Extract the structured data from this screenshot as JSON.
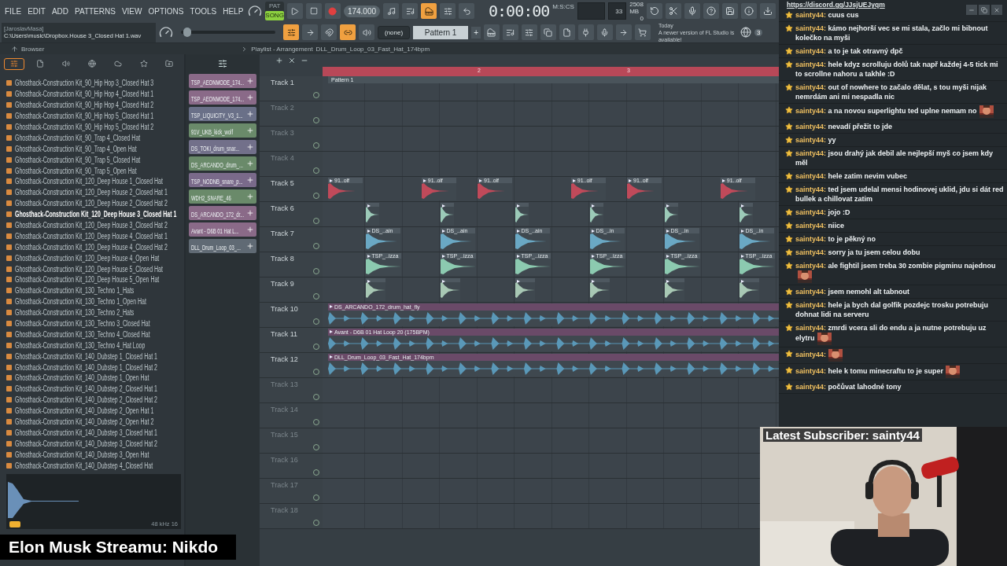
{
  "menu": [
    "FILE",
    "EDIT",
    "ADD",
    "PATTERNS",
    "VIEW",
    "OPTIONS",
    "TOOLS",
    "HELP"
  ],
  "transport": {
    "modes": [
      {
        "label": "PAT",
        "selected": false
      },
      {
        "label": "SONG",
        "selected": true
      }
    ],
    "tempo": "174.000",
    "time": "0:00:00",
    "time_unit": "M:S:CS",
    "cpu": "33",
    "memory": "2508 MB",
    "polyphony": "0"
  },
  "toggles_top": [
    {
      "on": false
    },
    {
      "on": false
    },
    {
      "on": true
    },
    {
      "on": false
    },
    {
      "on": false
    }
  ],
  "hint": {
    "title": "[JaroslavMasa]",
    "text": "C:\\Users\\music\\Dropbox.House 3_Closed Hat 1.wav"
  },
  "master_slider": {
    "level": 0.03
  },
  "toggles": [
    {
      "on": true
    },
    {
      "on": false
    },
    {
      "on": false
    },
    {
      "on": true
    },
    {
      "on": false
    }
  ],
  "snap": "(none)",
  "pattern": {
    "name": "Pattern 1",
    "add": "+"
  },
  "news": {
    "date": "Today",
    "text": "A newer version of FL Studio is available!",
    "count": "3"
  },
  "browser": {
    "title": "Browser",
    "tabs": [
      {
        "selected": true
      },
      {
        "selected": false
      },
      {
        "selected": false
      },
      {
        "selected": false
      },
      {
        "selected": false
      },
      {
        "selected": false
      },
      {
        "selected": false
      }
    ],
    "items": [
      {
        "name": "Ghosthack-Construction Kit_90_Hip Hop 3_Closed Hat 3",
        "selected": false
      },
      {
        "name": "Ghosthack-Construction Kit_90_Hip Hop 4_Closed Hat 1",
        "selected": false
      },
      {
        "name": "Ghosthack-Construction Kit_90_Hip Hop 4_Closed Hat 2",
        "selected": false
      },
      {
        "name": "Ghosthack-Construction Kit_90_Hip Hop 5_Closed Hat 1",
        "selected": false
      },
      {
        "name": "Ghosthack-Construction Kit_90_Hip Hop 5_Closed Hat 2",
        "selected": false
      },
      {
        "name": "Ghosthack-Construction Kit_90_Trap 4_Closed Hat",
        "selected": false
      },
      {
        "name": "Ghosthack-Construction Kit_90_Trap 4_Open Hat",
        "selected": false
      },
      {
        "name": "Ghosthack-Construction Kit_90_Trap 5_Closed Hat",
        "selected": false
      },
      {
        "name": "Ghosthack-Construction Kit_90_Trap 5_Open Hat",
        "selected": false
      },
      {
        "name": "Ghosthack-Construction Kit_120_Deep House 1_Closed Hat",
        "selected": false
      },
      {
        "name": "Ghosthack-Construction Kit_120_Deep House 2_Closed Hat 1",
        "selected": false
      },
      {
        "name": "Ghosthack-Construction Kit_120_Deep House 2_Closed Hat 2",
        "selected": false
      },
      {
        "name": "Ghosthack-Construction Kit_120_Deep House 3_Closed Hat 1",
        "selected": true
      },
      {
        "name": "Ghosthack-Construction Kit_120_Deep House 3_Closed Hat 2",
        "selected": false
      },
      {
        "name": "Ghosthack-Construction Kit_120_Deep House 4_Closed Hat 1",
        "selected": false
      },
      {
        "name": "Ghosthack-Construction Kit_120_Deep House 4_Closed Hat 2",
        "selected": false
      },
      {
        "name": "Ghosthack-Construction Kit_120_Deep House 4_Open Hat",
        "selected": false
      },
      {
        "name": "Ghosthack-Construction Kit_120_Deep House 5_Closed Hat",
        "selected": false
      },
      {
        "name": "Ghosthack-Construction Kit_120_Deep House 5_Open Hat",
        "selected": false
      },
      {
        "name": "Ghosthack-Construction Kit_130_Techno 1_Hats",
        "selected": false
      },
      {
        "name": "Ghosthack-Construction Kit_130_Techno 1_Open Hat",
        "selected": false
      },
      {
        "name": "Ghosthack-Construction Kit_130_Techno 2_Hats",
        "selected": false
      },
      {
        "name": "Ghosthack-Construction Kit_130_Techno 3_Closed Hat",
        "selected": false
      },
      {
        "name": "Ghosthack-Construction Kit_130_Techno 4_Closed Hat",
        "selected": false
      },
      {
        "name": "Ghosthack-Construction Kit_130_Techno 4_Hat Loop",
        "selected": false
      },
      {
        "name": "Ghosthack-Construction Kit_140_Dubstep 1_Closed Hat 1",
        "selected": false
      },
      {
        "name": "Ghosthack-Construction Kit_140_Dubstep 1_Closed Hat 2",
        "selected": false
      },
      {
        "name": "Ghosthack-Construction Kit_140_Dubstep 1_Open Hat",
        "selected": false
      },
      {
        "name": "Ghosthack-Construction Kit_140_Dubstep 2_Closed Hat 1",
        "selected": false
      },
      {
        "name": "Ghosthack-Construction Kit_140_Dubstep 2_Closed Hat 2",
        "selected": false
      },
      {
        "name": "Ghosthack-Construction Kit_140_Dubstep 2_Open Hat 1",
        "selected": false
      },
      {
        "name": "Ghosthack-Construction Kit_140_Dubstep 2_Open Hat 2",
        "selected": false
      },
      {
        "name": "Ghosthack-Construction Kit_140_Dubstep 3_Closed Hat 1",
        "selected": false
      },
      {
        "name": "Ghosthack-Construction Kit_140_Dubstep 3_Closed Hat 2",
        "selected": false
      },
      {
        "name": "Ghosthack-Construction Kit_140_Dubstep 3_Open Hat",
        "selected": false
      },
      {
        "name": "Ghosthack-Construction Kit_140_Dubstep 4_Closed Hat",
        "selected": false
      }
    ],
    "preview_info": "48 kHz 16"
  },
  "channels": [
    {
      "name": "TSP_AEONMODE_174...",
      "color": "#8a6a88"
    },
    {
      "name": "TSP_AEONMODE_174...",
      "color": "#8a6a88"
    },
    {
      "name": "TSP_LIQUICITY_V3_1...",
      "color": "#6a7088"
    },
    {
      "name": "91V_UKB_kick_wolf",
      "color": "#6a8a6a"
    },
    {
      "name": "DS_TOKI_drum_snar...",
      "color": "#72708a"
    },
    {
      "name": "DS_ARCANDO_drum_...",
      "color": "#6a8a6a"
    },
    {
      "name": "TSP_NODNB_snare_p...",
      "color": "#7a6a8a"
    },
    {
      "name": "WDH2_SNARE_46",
      "color": "#6a8a6a"
    },
    {
      "name": "DS_ARCANDO_172_dr...",
      "color": "#8a6a88"
    },
    {
      "name": "Avant - D6B 01 Hat L...",
      "color": "#8a6a88"
    },
    {
      "name": "DLL_Drum_Loop_03_...",
      "color": "#606a74"
    }
  ],
  "playlist": {
    "title": "Playlist - Arrangement",
    "pattern_name": "DLL_Drum_Loop_03_Fast_Hat_174bpm",
    "ruler": [
      "2",
      "3"
    ],
    "tracks": [
      {
        "name": "Track 1",
        "clips": [
          {
            "kind": "pattern",
            "label": "Pattern 1"
          }
        ]
      },
      {
        "name": "Track 2"
      },
      {
        "name": "Track 3"
      },
      {
        "name": "Track 4"
      },
      {
        "name": "Track 5",
        "color": "#c04a5a",
        "clips": [
          {
            "kind": "audio",
            "label": "91..olf"
          },
          {
            "kind": "audio",
            "label": "91..olf"
          },
          {
            "kind": "audio",
            "label": "91..olf"
          },
          {
            "kind": "audio",
            "label": "91..olf"
          },
          {
            "kind": "audio",
            "label": "91..olf"
          },
          {
            "kind": "audio",
            "label": "91..olf"
          }
        ]
      },
      {
        "name": "Track 6",
        "color": "#9ccab8",
        "clips": [
          {
            "kind": "audio"
          },
          {
            "kind": "audio"
          },
          {
            "kind": "audio"
          },
          {
            "kind": "audio"
          },
          {
            "kind": "audio"
          },
          {
            "kind": "audio"
          }
        ]
      },
      {
        "name": "Track 7",
        "color": "#6aa8c4",
        "clips": [
          {
            "kind": "audio",
            "label": "DS_..ain"
          },
          {
            "kind": "audio",
            "label": "DS_..ain"
          },
          {
            "kind": "audio",
            "label": "DS_..ain"
          },
          {
            "kind": "audio",
            "label": "DS_..in"
          },
          {
            "kind": "audio",
            "label": "DS_..in"
          },
          {
            "kind": "audio",
            "label": "DS_..in"
          }
        ]
      },
      {
        "name": "Track 8",
        "color": "#8ccab0",
        "clips": [
          {
            "kind": "audio",
            "label": "TSP_..izza"
          },
          {
            "kind": "audio",
            "label": "TSP_..izza"
          },
          {
            "kind": "audio",
            "label": "TSP_..izza"
          },
          {
            "kind": "audio",
            "label": "TSP_..izza"
          },
          {
            "kind": "audio",
            "label": "TSP_..izza"
          },
          {
            "kind": "audio",
            "label": "TSP_..izza"
          }
        ]
      },
      {
        "name": "Track 9",
        "color": "#a8c8b4",
        "clips": [
          {
            "kind": "audio"
          },
          {
            "kind": "audio"
          },
          {
            "kind": "audio"
          },
          {
            "kind": "audio"
          },
          {
            "kind": "audio"
          },
          {
            "kind": "audio"
          }
        ]
      },
      {
        "name": "Track 10",
        "color": "#5a98b8",
        "clips": [
          {
            "kind": "loop",
            "label": "DS_ARCANDO_172_drum_hat_fly"
          }
        ]
      },
      {
        "name": "Track 11",
        "color": "#5a98b8",
        "clips": [
          {
            "kind": "loop",
            "label": "Avant - D6B 01 Hat Loop 20 (175BPM)"
          }
        ]
      },
      {
        "name": "Track 12",
        "color": "#5a98b8",
        "clips": [
          {
            "kind": "loop",
            "label": "DLL_Drum_Loop_03_Fast_Hat_174bpm"
          }
        ]
      },
      {
        "name": "Track 13"
      },
      {
        "name": "Track 14"
      },
      {
        "name": "Track 15"
      },
      {
        "name": "Track 16"
      },
      {
        "name": "Track 17"
      },
      {
        "name": "Track 18"
      }
    ]
  },
  "chat": {
    "link": "https://discord.gg/JJsjUEJyqm",
    "messages": [
      {
        "user": "sainty44:",
        "text": "cuus cus",
        "emote": false
      },
      {
        "user": "sainty44:",
        "text": "kámo nejhorší vec se mi stala, začlo mi bibnout kolečko na myši",
        "emote": false
      },
      {
        "user": "sainty44:",
        "text": "a to je tak otravný dpč",
        "emote": false
      },
      {
        "user": "sainty44:",
        "text": "hele kdyz scrolluju dolů tak např každej 4-5 tick mi to scrollne nahoru a takhle :D",
        "emote": false
      },
      {
        "user": "sainty44:",
        "text": "out of nowhere to začalo dělat, s tou myši nijak nemrdám ani mi nespadla nic",
        "emote": false
      },
      {
        "user": "sainty44:",
        "text": "a na novou superlightu ted uplne nemam no",
        "emote": true
      },
      {
        "user": "sainty44:",
        "text": "nevadí přežit to jde",
        "emote": false
      },
      {
        "user": "sainty44:",
        "text": "yy",
        "emote": false
      },
      {
        "user": "sainty44:",
        "text": "jsou drahý jak debil ale nejlepší myš co jsem kdy měl",
        "emote": false
      },
      {
        "user": "sainty44:",
        "text": "hele zatim nevim vubec",
        "emote": false
      },
      {
        "user": "sainty44:",
        "text": "ted jsem udelal mensi hodinovej uklid, jdu si dát red bullek a chillovat zatim",
        "emote": false
      },
      {
        "user": "sainty44:",
        "text": "jojo :D",
        "emote": false
      },
      {
        "user": "sainty44:",
        "text": "niice",
        "emote": false
      },
      {
        "user": "sainty44:",
        "text": "to je pěkný no",
        "emote": false
      },
      {
        "user": "sainty44:",
        "text": "sorry ja tu jsem celou dobu",
        "emote": false
      },
      {
        "user": "sainty44:",
        "text": "ale fightil jsem treba 30 zombie pigminu najednou",
        "emote": true
      },
      {
        "user": "sainty44:",
        "text": "jsem nemohl alt tabnout",
        "emote": false
      },
      {
        "user": "sainty44:",
        "text": "hele ja bych dal golfik pozdejc trosku potrebuju dohnat lidi na serveru",
        "emote": false
      },
      {
        "user": "sainty44:",
        "text": "zmrdi vcera sli do endu a ja nutne potrebuju uz elytru",
        "emote": true
      },
      {
        "user": "sainty44:",
        "emote": true
      },
      {
        "user": "sainty44:",
        "text": "hele k tomu minecraftu to je super",
        "emote": true
      },
      {
        "user": "sainty44:",
        "text": "počůvat lahodné tony",
        "emote": false
      }
    ]
  },
  "stream": {
    "subscriber": "Latest Subscriber: sainty44",
    "caption": "Elon Musk Streamu: Nikdo"
  }
}
